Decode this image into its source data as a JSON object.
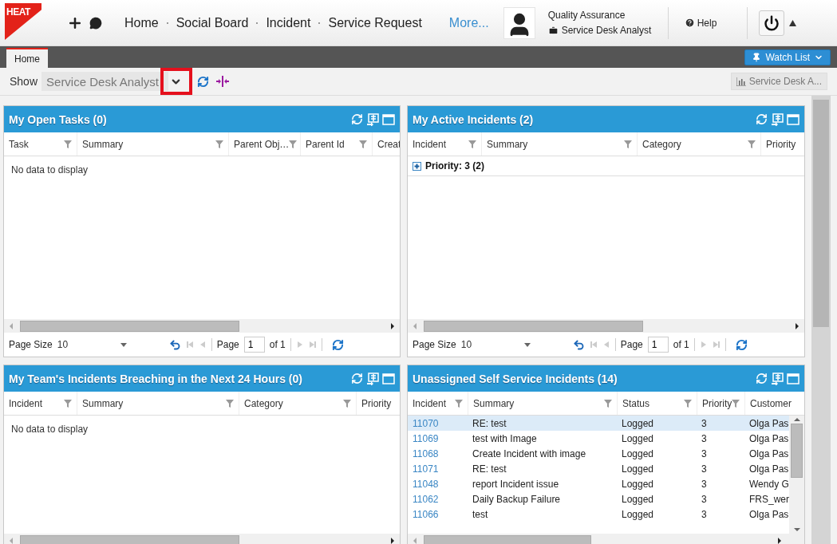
{
  "header": {
    "logo": "HEAT",
    "nav": [
      {
        "label": "Home"
      },
      {
        "label": "Social Board"
      },
      {
        "label": "Incident"
      },
      {
        "label": "Service Request"
      }
    ],
    "more": "More...",
    "user": {
      "name": "Quality Assurance",
      "role": "Service Desk Analyst"
    },
    "help": "Help"
  },
  "tabs": [
    {
      "label": "Home",
      "selected": true
    }
  ],
  "watch_list": "Watch List",
  "toolbar": {
    "show_label": "Show",
    "dashboard": "Service Desk Analyst",
    "dropdown_highlighted": true,
    "layout_button": "Service Desk A..."
  },
  "panels": [
    {
      "title": "My Open Tasks (0)",
      "columns": [
        "Task",
        "Summary",
        "Parent Obj…",
        "Parent Id",
        "Creat"
      ],
      "empty_message": "No data to display",
      "footer": {
        "page_size_label": "Page Size",
        "page_size": "10",
        "page_label": "Page",
        "page": "1",
        "of": "of 1"
      }
    },
    {
      "title": "My Active Incidents (2)",
      "columns": [
        "Incident",
        "Summary",
        "Category",
        "Priority"
      ],
      "groups": [
        {
          "label": "Priority: 3 (2)",
          "expanded": false
        }
      ],
      "footer": {
        "page_size_label": "Page Size",
        "page_size": "10",
        "page_label": "Page",
        "page": "1",
        "of": "of 1"
      }
    },
    {
      "title": "My Team's Incidents Breaching in the Next 24 Hours (0)",
      "columns": [
        "Incident",
        "Summary",
        "Category",
        "Priority"
      ],
      "empty_message": "No data to display"
    },
    {
      "title": "Unassigned Self Service Incidents (14)",
      "columns": [
        "Incident",
        "Summary",
        "Status",
        "Priority",
        "Customer"
      ],
      "rows": [
        {
          "incident": "11070",
          "summary": "RE: test",
          "status": "Logged",
          "priority": "3",
          "customer": "Olga Pas",
          "selected": true
        },
        {
          "incident": "11069",
          "summary": "test with Image",
          "status": "Logged",
          "priority": "3",
          "customer": "Olga Pas",
          "selected": false
        },
        {
          "incident": "11068",
          "summary": "Create Incident with image",
          "status": "Logged",
          "priority": "3",
          "customer": "Olga Pas",
          "selected": false
        },
        {
          "incident": "11071",
          "summary": "RE: test",
          "status": "Logged",
          "priority": "3",
          "customer": "Olga Pas",
          "selected": false
        },
        {
          "incident": "11048",
          "summary": "report Incident issue",
          "status": "Logged",
          "priority": "3",
          "customer": "Wendy G",
          "selected": false
        },
        {
          "incident": "11062",
          "summary": "Daily Backup Failure",
          "status": "Logged",
          "priority": "3",
          "customer": "FRS_wer",
          "selected": false
        },
        {
          "incident": "11066",
          "summary": "test",
          "status": "Logged",
          "priority": "3",
          "customer": "Olga Pas",
          "selected": false
        }
      ]
    }
  ]
}
